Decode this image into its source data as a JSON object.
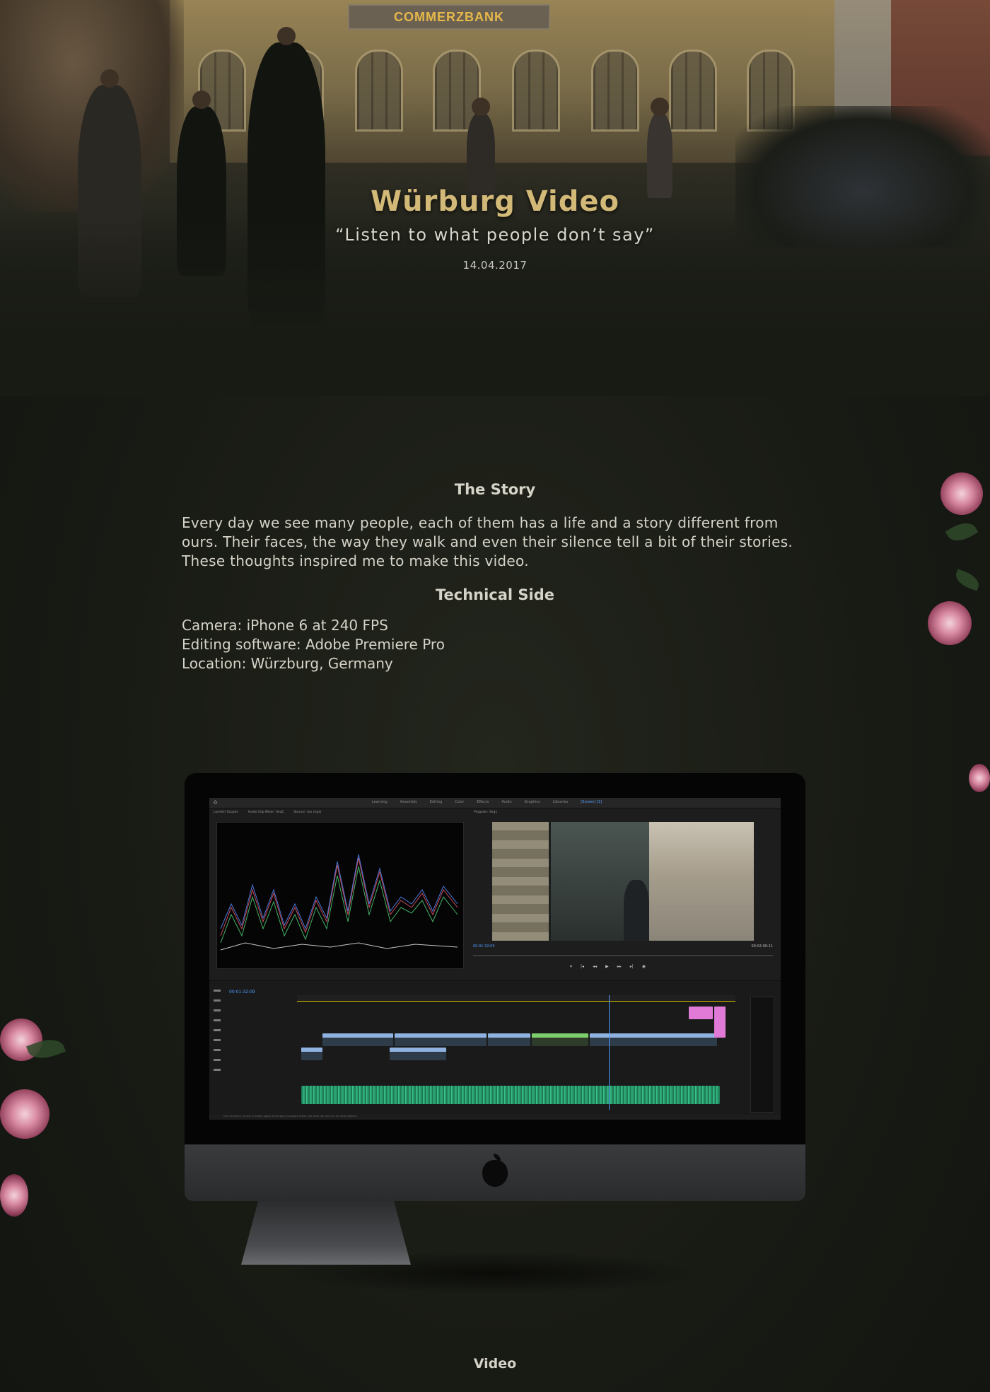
{
  "hero": {
    "bank_sign": "COMMERZBANK",
    "title": "Würburg Video",
    "quote": "“Listen to what people don’t say”",
    "date": "14.04.2017"
  },
  "story": {
    "heading": "The Story",
    "body": "Every day we see many people, each of them has a life and a story different from ours. Their faces, the way they walk and even their silence tell a bit of their stories. These thoughts inspired me to make this video.",
    "tech_heading": "Technical Side",
    "tech_items": [
      "Camera: iPhone 6 at 240 FPS",
      "Editing software: Adobe Premiere Pro",
      "Location: Würzburg, Germany"
    ]
  },
  "screen": {
    "workspace_tabs": [
      "Learning",
      "Assembly",
      "Editing",
      "Color",
      "Effects",
      "Audio",
      "Graphics",
      "Libraries",
      "[Screen] [1]"
    ],
    "left_panel_tabs": [
      "Lumetri Scopes",
      "Audio Clip Mixer: Seq1",
      "Source: (no clips)"
    ],
    "program_tab": "Program: Seq1",
    "program_time_left": "00:01:32:09",
    "program_time_right": "00:02:00:11",
    "timeline_time": "00:01:32:09",
    "status_text": "Click to select, or click in empty space and drag to marquee select. Use Shift, Alt, and Ctrl for other options."
  },
  "footer": {
    "label": "Video"
  },
  "colors": {
    "accent_title": "#d3b978",
    "text": "#d6d3c8",
    "background": "#181a14"
  }
}
